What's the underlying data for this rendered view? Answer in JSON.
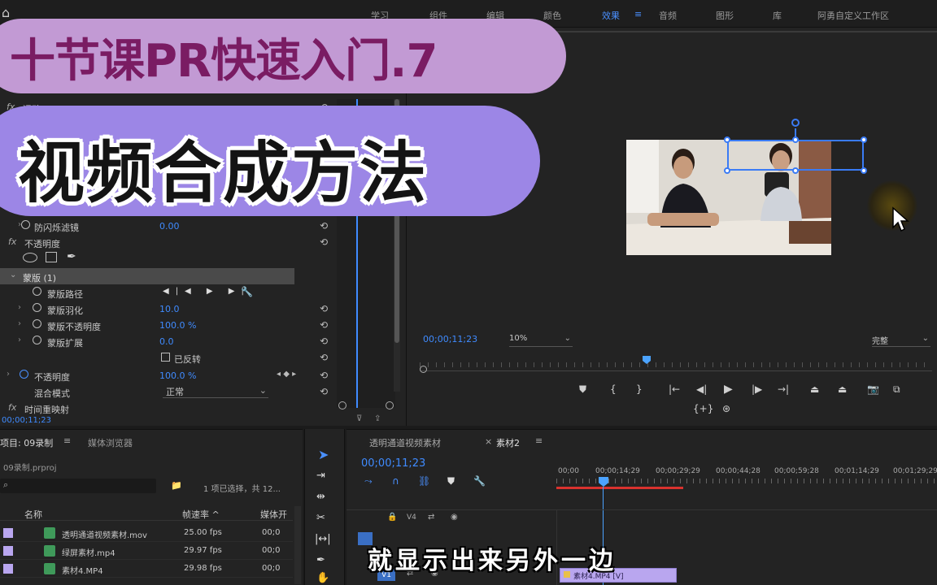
{
  "workspaces": [
    "学习",
    "组件",
    "编辑",
    "颜色",
    "效果",
    "音频",
    "图形",
    "库",
    "阿勇自定义工作区"
  ],
  "active_workspace": "效果",
  "title_banner": {
    "line1": "十节课PR快速入门.7",
    "line2": "视频合成方法"
  },
  "effect_controls": {
    "header_label": "运动",
    "flicker": {
      "label": "防闪烁滤镜",
      "value": "0.00"
    },
    "opacity_label": "不透明度",
    "mask_label": "蒙版 (1)",
    "mask_path_label": "蒙版路径",
    "mask_feather": {
      "label": "蒙版羽化",
      "value": "10.0"
    },
    "mask_opacity": {
      "label": "蒙版不透明度",
      "value": "100.0 %"
    },
    "mask_expansion": {
      "label": "蒙版扩展",
      "value": "0.0"
    },
    "inverted_label": "已反转",
    "opacity": {
      "label": "不透明度",
      "value": "100.0 %"
    },
    "blend_mode": {
      "label": "混合模式",
      "value": "正常"
    },
    "time_remap_label": "时间重映射",
    "timecode": "00;00;11;23"
  },
  "program_monitor": {
    "timecode": "00;00;11;23",
    "zoom": "10%",
    "quality": "完整"
  },
  "project_panel": {
    "tab_project": "项目: 09录制",
    "tab_media": "媒体浏览器",
    "file": "09录制.prproj",
    "selection_info": "1 项已选择，共 12...",
    "col_name": "名称",
    "col_rate": "帧速率 ^",
    "col_media": "媒体开",
    "items": [
      {
        "name": "透明通道视频素材.mov",
        "fps": "25.00 fps",
        "media": "00;0",
        "color": "#b9a6ef"
      },
      {
        "name": "绿屏素材.mp4",
        "fps": "29.97 fps",
        "media": "00;0",
        "color": "#b9a6ef"
      },
      {
        "name": "素材4.MP4",
        "fps": "29.98 fps",
        "media": "00;0",
        "color": "#b9a6ef"
      }
    ]
  },
  "timeline": {
    "tab1": "透明通道视频素材",
    "tab2": "素材2",
    "tab2_menu": "≡",
    "timecode": "00;00;11;23",
    "ruler": [
      "00;00",
      "00;00;14;29",
      "00;00;29;29",
      "00;00;44;28",
      "00;00;59;28",
      "00;01;14;29",
      "00;01;29;29"
    ],
    "track_v1": "V1",
    "track_v4": "V4",
    "clip_label": "素材4.MP4 [V]"
  },
  "subtitle": "就显示出来另外一边",
  "colors": {
    "accent": "#3f8bff",
    "banner1": "#c29ad4",
    "banner2": "#9c86e6",
    "title1_text": "#7a1c63",
    "playhead": "#4ba3ff",
    "work_area": "#d9322e"
  }
}
